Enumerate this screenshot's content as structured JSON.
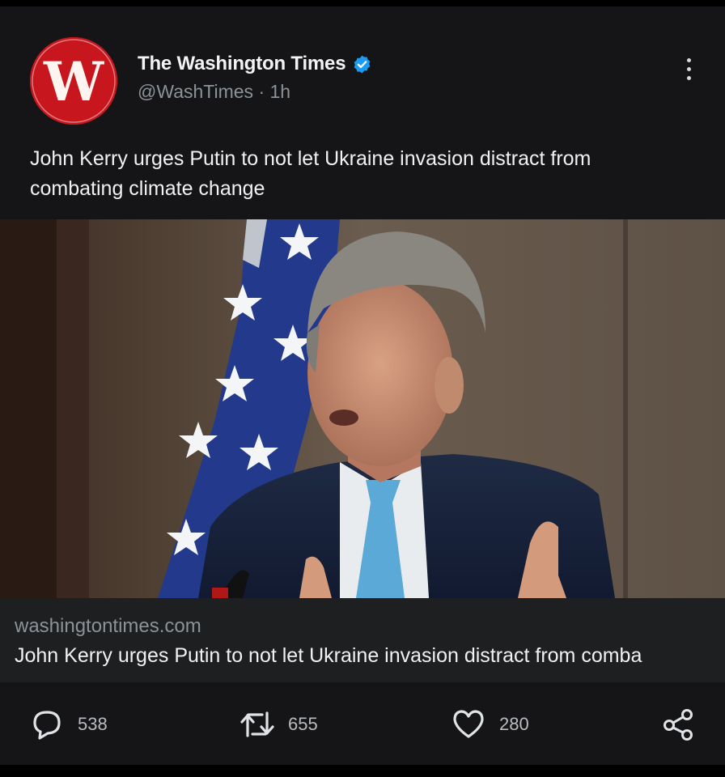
{
  "account": {
    "display_name": "The Washington Times",
    "handle": "@WashTimes",
    "time": "1h",
    "avatar_icon": "washington-times-logo",
    "avatar_letter": "W",
    "brand_color": "#c8161e",
    "verified_color": "#1d9bf0"
  },
  "tweet": {
    "text": "John Kerry urges Putin to not let Ukraine invasion distract from combating climate change"
  },
  "link_card": {
    "domain": "washingtontimes.com",
    "title": "John Kerry urges Putin to not let Ukraine invasion distract from comba"
  },
  "actions": {
    "replies": "538",
    "retweets": "655",
    "likes": "280"
  },
  "icons": {
    "reply": "reply-icon",
    "retweet": "retweet-icon",
    "like": "heart-icon",
    "share": "share-icon",
    "more": "more-options-icon",
    "verified": "verified-badge-icon"
  }
}
